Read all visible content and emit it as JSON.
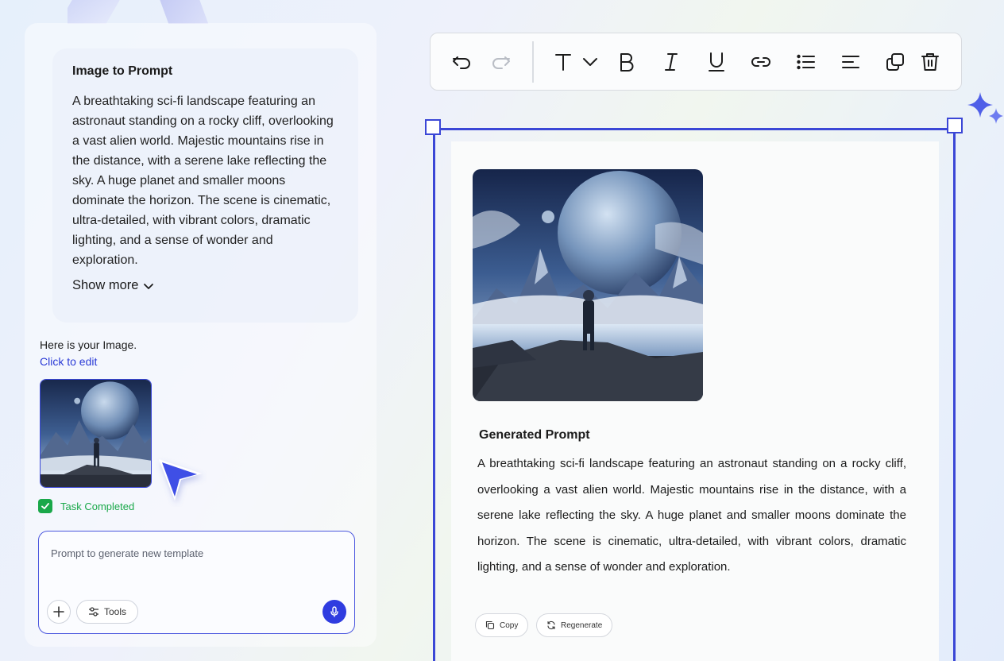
{
  "sidebar": {
    "prompt_card": {
      "title": "Image to Prompt",
      "description": "A breathtaking sci-fi landscape featuring an astronaut standing on a rocky cliff, overlooking a vast alien world. Majestic mountains rise in the distance, with a serene lake reflecting the sky. A huge planet and smaller moons dominate the horizon. The scene is cinematic, ultra-detailed, with vibrant colors, dramatic lighting, and a sense of wonder and exploration.",
      "show_more_label": "Show more"
    },
    "image_message": "Here is your Image.",
    "edit_link": "Click to edit",
    "task_status": "Task Completed",
    "chat": {
      "placeholder": "Prompt to generate new template",
      "tools_label": "Tools"
    }
  },
  "toolbar": {
    "icons": [
      "undo-icon",
      "redo-icon",
      "text-icon",
      "chevron-down-icon",
      "bold-icon",
      "italic-icon",
      "underline-icon",
      "link-icon",
      "list-icon",
      "align-left-icon",
      "duplicate-icon",
      "trash-icon"
    ]
  },
  "canvas": {
    "generated_title": "Generated Prompt",
    "generated_text": "A breathtaking sci-fi landscape featuring an astronaut standing on a rocky cliff, overlooking a vast alien world. Majestic mountains rise in the distance, with a serene lake reflecting the sky. A huge planet and smaller moons dominate the horizon. The scene is cinematic, ultra-detailed, with vibrant colors, dramatic lighting, and a sense of wonder and exploration.",
    "copy_label": "Copy",
    "regenerate_label": "Regenerate"
  },
  "colors": {
    "accent": "#3b47d6",
    "success": "#1aa84a",
    "link": "#2a3ad6"
  }
}
